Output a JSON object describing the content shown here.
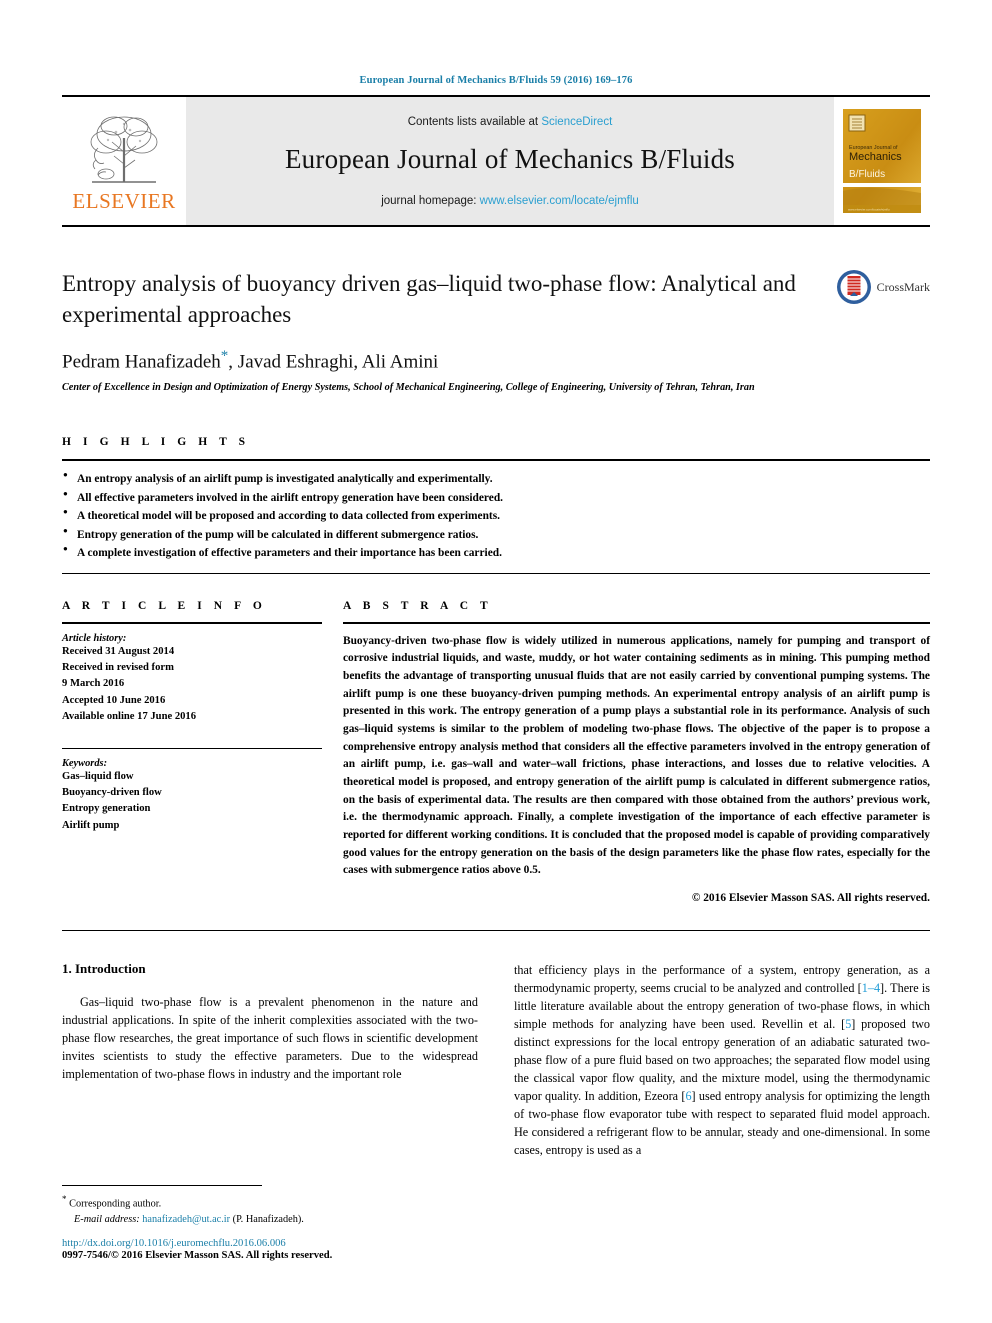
{
  "running_head": "European Journal of Mechanics B/Fluids 59 (2016) 169–176",
  "masthead": {
    "publisher_name": "ELSEVIER",
    "contents_prefix": "Contents lists available at ",
    "sciencedirect": "ScienceDirect",
    "journal_name": "European Journal of Mechanics B/Fluids",
    "homepage_prefix": "journal homepage: ",
    "homepage_url": "www.elsevier.com/locate/ejmflu",
    "cover": {
      "line1": "European Journal of",
      "line2": "Mechanics",
      "line3": "B/Fluids"
    }
  },
  "article": {
    "title": "Entropy analysis of buoyancy driven gas–liquid two-phase flow: Analytical and experimental approaches",
    "authors": "Pedram Hanafizadeh",
    "authors_rest": ", Javad Eshraghi, Ali Amini",
    "corresponding_marker": "*",
    "affiliation": "Center of Excellence in Design and Optimization of Energy Systems, School of Mechanical Engineering, College of Engineering, University of Tehran, Tehran, Iran",
    "crossmark_label": "CrossMark"
  },
  "highlights": {
    "heading": "H I G H L I G H T S",
    "items": [
      "An entropy analysis of an airlift pump is investigated analytically and experimentally.",
      "All effective parameters involved in the airlift entropy generation have been considered.",
      "A theoretical model will be proposed and according to data collected from experiments.",
      "Entropy generation of the pump will be calculated in different submergence ratios.",
      "A complete investigation of effective parameters and their importance has been carried."
    ]
  },
  "article_info": {
    "heading": "A R T I C L E    I N F O",
    "history_label": "Article history:",
    "history": [
      "Received 31 August 2014",
      "Received in revised form",
      "9 March 2016",
      "Accepted 10 June 2016",
      "Available online 17 June 2016"
    ],
    "keywords_label": "Keywords:",
    "keywords": [
      "Gas–liquid flow",
      "Buoyancy-driven flow",
      "Entropy generation",
      "Airlift pump"
    ]
  },
  "abstract": {
    "heading": "A B S T R A C T",
    "text": "Buoyancy-driven two-phase flow is widely utilized in numerous applications, namely for pumping and transport of corrosive industrial liquids, and waste, muddy, or hot water containing sediments as in mining. This pumping method benefits the advantage of transporting unusual fluids that are not easily carried by conventional pumping systems. The airlift pump is one these buoyancy-driven pumping methods. An experimental entropy analysis of an airlift pump is presented in this work. The entropy generation of a pump plays a substantial role in its performance. Analysis of such gas–liquid systems is similar to the problem of modeling two-phase flows. The objective of the paper is to propose a comprehensive entropy analysis method that considers all the effective parameters involved in the entropy generation of an airlift pump, i.e. gas–wall and water–wall frictions, phase interactions, and losses due to relative velocities. A theoretical model is proposed, and entropy generation of the airlift pump is calculated in different submergence ratios, on the basis of experimental data. The results are then compared with those obtained from the authors’ previous work, i.e. the thermodynamic approach. Finally, a complete investigation of the importance of each effective parameter is reported for different working conditions. It is concluded that the proposed model is capable of providing comparatively good values for the entropy generation on the basis of the design parameters like the phase flow rates, especially for the cases with submergence ratios above 0.5.",
    "copyright": "© 2016 Elsevier Masson SAS. All rights reserved."
  },
  "introduction": {
    "section_number_title": "1. Introduction",
    "left_paragraph": "Gas–liquid two-phase flow is a prevalent phenomenon in the nature and industrial applications. In spite of the inherit complexities associated with the two-phase flow researches, the great importance of such flows in scientific development invites scientists to study the effective parameters. Due to the widespread implementation of two-phase flows in industry and the important role",
    "right_part1": "that efficiency plays in the performance of a system, entropy generation, as a thermodynamic property, seems crucial to be analyzed and controlled [",
    "right_ref1": "1–4",
    "right_part2": "]. There is little literature available about the entropy generation of two-phase flows, in which simple methods for analyzing have been used. Revellin et al. [",
    "right_ref2": "5",
    "right_part3": "] proposed two distinct expressions for the local entropy generation of an adiabatic saturated two-phase flow of a pure fluid based on two approaches; the separated flow model using the classical vapor flow quality, and the mixture model, using the thermodynamic vapor quality. In addition, Ezeora [",
    "right_ref3": "6",
    "right_part4": "] used entropy analysis for optimizing the length of two-phase flow evaporator tube with respect to separated fluid model approach. He considered a refrigerant flow to be annular, steady and one-dimensional. In some cases, entropy is used as a"
  },
  "footer": {
    "corresponding_marker": "*",
    "corresponding_label": "Corresponding author.",
    "email_label": "E-mail address:",
    "email": "hanafizadeh@ut.ac.ir",
    "email_suffix": "(P. Hanafizadeh).",
    "doi": "http://dx.doi.org/10.1016/j.euromechflu.2016.06.006",
    "issn_line": "0997-7546/© 2016 Elsevier Masson SAS. All rights reserved."
  },
  "colors": {
    "link_blue": "#1b7fa8",
    "sciencedirect_blue": "#2a9fd0",
    "elsevier_orange": "#E87722",
    "reference_blue": "#1b9ad6",
    "masthead_gray": "#e9e9e9"
  }
}
